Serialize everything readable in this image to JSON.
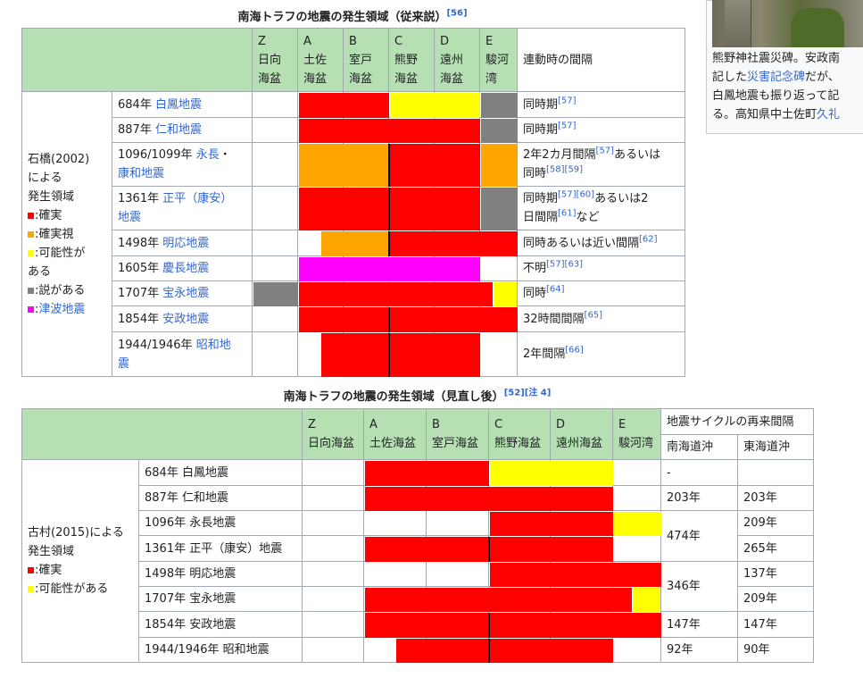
{
  "table1": {
    "caption": "南海トラフの地震の発生領域（従来説）",
    "caption_ref": "[56]",
    "headers": [
      {
        "code": "Z",
        "l1": "日向",
        "l2": "海盆"
      },
      {
        "code": "A",
        "l1": "土佐",
        "l2": "海盆"
      },
      {
        "code": "B",
        "l1": "室戸",
        "l2": "海盆"
      },
      {
        "code": "C",
        "l1": "熊野",
        "l2": "海盆"
      },
      {
        "code": "D",
        "l1": "遠州",
        "l2": "海盆"
      },
      {
        "code": "E",
        "l1": "駿河",
        "l2": "湾"
      }
    ],
    "interval_header": "連動時の間隔",
    "side": {
      "l1": "石橋(2002)",
      "l2": "による",
      "l3": "発生領域",
      "legend": [
        {
          "swatch": "■",
          "color": "#ff0000",
          "text": ":確実"
        },
        {
          "swatch": "■",
          "color": "#ffa500",
          "text": ":確実視"
        },
        {
          "swatch": "■",
          "color": "#ffff00",
          "text": ":可能性が",
          "text2": "ある"
        },
        {
          "swatch": "■",
          "color": "#808080",
          "text": ":説がある"
        },
        {
          "swatch": "■",
          "color": "#ff00ff",
          "text": ":",
          "link": "津波地震"
        }
      ]
    },
    "rows": [
      {
        "year": "684年",
        "name": "白鳳地震",
        "name2": "",
        "note": "同時期",
        "ref": "[57]",
        "note2": ""
      },
      {
        "year": "887年",
        "name": "仁和地震",
        "name2": "",
        "note": "同時期",
        "ref": "[57]",
        "note2": ""
      },
      {
        "year": "1096/1099年",
        "name": "永長",
        "sep": "・",
        "name2": "康和地震",
        "note": "2年2カ月間隔",
        "ref": "[57]",
        "note_b": "あるいは",
        "note2": "同時",
        "ref2": "[58][59]"
      },
      {
        "year": "1361年",
        "name": "正平（康安）",
        "name2": "地震",
        "note": "同時期",
        "ref": "[57][60]",
        "note_b": "あるいは2",
        "note2": "日間隔",
        "ref2": "[61]",
        "note2_b": "など"
      },
      {
        "year": "1498年",
        "name": "明応地震",
        "name2": "",
        "note": "同時あるいは近い間隔",
        "ref": "[62]",
        "note2": ""
      },
      {
        "year": "1605年",
        "name": "慶長地震",
        "name2": "",
        "note": "不明",
        "ref": "[57][63]",
        "note2": ""
      },
      {
        "year": "1707年",
        "name": "宝永地震",
        "name2": "",
        "note": "同時",
        "ref": "[64]",
        "note2": ""
      },
      {
        "year": "1854年",
        "name": "安政地震",
        "name2": "",
        "note": "32時間間隔",
        "ref": "[65]",
        "note2": ""
      },
      {
        "year": "1944/1946年",
        "name": "昭和地",
        "name2": "震",
        "note": "2年間隔",
        "ref": "[66]",
        "note2": ""
      }
    ],
    "segments": [
      [
        {
          "from": 1.0,
          "to": 3.0,
          "color": "#ff0000"
        },
        {
          "from": 3.0,
          "to": 5.0,
          "color": "#ffff00"
        },
        {
          "from": 5.0,
          "to": 6.0,
          "color": "#808080"
        }
      ],
      [
        {
          "from": 1.0,
          "to": 5.0,
          "color": "#ff0000"
        },
        {
          "from": 5.0,
          "to": 6.0,
          "color": "#808080"
        }
      ],
      [
        {
          "from": 1.0,
          "to": 3.0,
          "color": "#ffa500"
        },
        {
          "from": 3.0,
          "to": 5.0,
          "color": "#ff0000"
        },
        {
          "from": 5.0,
          "to": 6.0,
          "color": "#ffa500"
        }
      ],
      [
        {
          "from": 1.0,
          "to": 5.0,
          "color": "#ff0000"
        },
        {
          "from": 5.0,
          "to": 6.0,
          "color": "#808080"
        }
      ],
      [
        {
          "from": 1.5,
          "to": 3.0,
          "color": "#ffa500"
        },
        {
          "from": 3.0,
          "to": 6.0,
          "color": "#ff0000"
        }
      ],
      [
        {
          "from": 1.0,
          "to": 5.0,
          "color": "#ff00ff"
        }
      ],
      [
        {
          "from": 0.0,
          "to": 1.0,
          "color": "#808080"
        },
        {
          "from": 1.0,
          "to": 5.35,
          "color": "#ff0000"
        },
        {
          "from": 5.35,
          "to": 6.0,
          "color": "#ffff00"
        }
      ],
      [
        {
          "from": 1.0,
          "to": 6.0,
          "color": "#ff0000"
        }
      ],
      [
        {
          "from": 1.5,
          "to": 5.0,
          "color": "#ff0000"
        }
      ]
    ],
    "dividers": [
      2,
      3,
      4,
      7,
      8
    ]
  },
  "table2": {
    "caption": "南海トラフの地震の発生領域（見直し後）",
    "caption_ref": "[52][注 4]",
    "headers": [
      {
        "code": "Z",
        "l1": "日向海盆"
      },
      {
        "code": "A",
        "l1": "土佐海盆"
      },
      {
        "code": "B",
        "l1": "室戸海盆"
      },
      {
        "code": "C",
        "l1": "熊野海盆"
      },
      {
        "code": "D",
        "l1": "遠州海盆"
      },
      {
        "code": "E",
        "l1": "駿河湾"
      }
    ],
    "cycle_header": "地震サイクルの再来間隔",
    "nankai_header": "南海道沖",
    "tokai_header": "東海道沖",
    "side": {
      "l1": "古村(2015)による",
      "l2": "発生領域",
      "legend": [
        {
          "swatch": "■",
          "color": "#ff0000",
          "text": ":確実"
        },
        {
          "swatch": "■",
          "color": "#ffff00",
          "text": ":可能性がある"
        }
      ]
    },
    "rows": [
      {
        "event": "684年 白鳳地震",
        "tokai": ""
      },
      {
        "event": "887年 仁和地震",
        "tokai": "203年"
      },
      {
        "event": "1096年 永長地震",
        "tokai": "209年"
      },
      {
        "event": "1361年 正平（康安）地震",
        "tokai": "265年"
      },
      {
        "event": "1498年 明応地震",
        "tokai": "137年"
      },
      {
        "event": "1707年 宝永地震",
        "tokai": "209年"
      },
      {
        "event": "1854年 安政地震",
        "tokai": "147年"
      },
      {
        "event": "1944/1946年 昭和地震",
        "tokai": "90年"
      }
    ],
    "nankai": [
      {
        "text": "-",
        "rowspan": 1
      },
      {
        "text": "203年",
        "rowspan": 1
      },
      {
        "text": "474年",
        "rowspan": 2
      },
      {
        "text": "346年",
        "rowspan": 2
      },
      {
        "text": "147年",
        "rowspan": 1
      },
      {
        "text": "92年",
        "rowspan": 1
      }
    ],
    "tokai_first": "",
    "segments": [
      [
        {
          "from": 1.0,
          "to": 3.0,
          "color": "#ff0000"
        },
        {
          "from": 3.0,
          "to": 5.0,
          "color": "#ffff00"
        }
      ],
      [
        {
          "from": 1.0,
          "to": 5.0,
          "color": "#ff0000"
        }
      ],
      [
        {
          "from": 3.0,
          "to": 5.0,
          "color": "#ff0000"
        },
        {
          "from": 5.0,
          "to": 6.0,
          "color": "#ffff00"
        }
      ],
      [
        {
          "from": 1.0,
          "to": 5.0,
          "color": "#ff0000"
        }
      ],
      [
        {
          "from": 3.0,
          "to": 6.0,
          "color": "#ff0000"
        }
      ],
      [
        {
          "from": 1.0,
          "to": 5.4,
          "color": "#ff0000"
        },
        {
          "from": 5.4,
          "to": 6.0,
          "color": "#ffff00"
        }
      ],
      [
        {
          "from": 1.0,
          "to": 6.0,
          "color": "#ff0000"
        }
      ],
      [
        {
          "from": 1.5,
          "to": 5.0,
          "color": "#ff0000"
        }
      ]
    ],
    "dividers": [
      3,
      6,
      7
    ]
  },
  "thumb": {
    "line1": "熊野神社震災碑。安政南",
    "line2_a": "記した",
    "line2_link": "災害記念碑",
    "line2_b": "だが、",
    "line3": "白鳳地震も振り返って記",
    "line4_a": "る。高知県中土佐町",
    "line4_link": "久礼"
  }
}
